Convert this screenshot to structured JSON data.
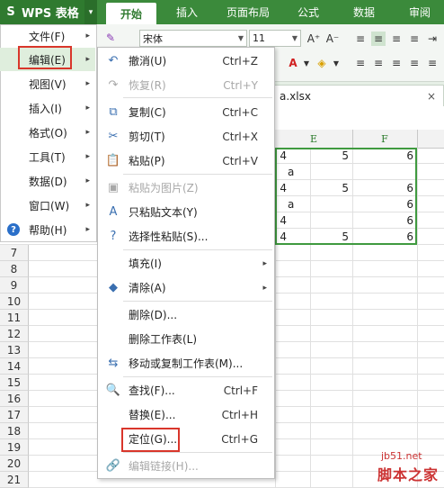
{
  "app": {
    "logo_glyph": "S",
    "title": "WPS 表格",
    "arrow": "▾"
  },
  "ribbon_tabs": [
    "开始",
    "插入",
    "页面布局",
    "公式",
    "数据",
    "审阅"
  ],
  "ribbon": {
    "font_name": "宋体",
    "font_size": "11",
    "grow": "A⁺",
    "shrink": "A⁻"
  },
  "doc_tab": {
    "name": "a.xlsx",
    "close": "×"
  },
  "columns": [
    "E",
    "F"
  ],
  "rows": [
    {
      "num": "",
      "c1": "4",
      "c2": "5",
      "c3": "6"
    },
    {
      "num": "",
      "c1": "",
      "c1t": "a",
      "c2": "",
      "c3": ""
    },
    {
      "num": "",
      "c1": "4",
      "c2": "5",
      "c3": "6"
    },
    {
      "num": "",
      "c1": "",
      "c1t": "a",
      "c2": "",
      "c3": "6"
    },
    {
      "num": "",
      "c1": "4",
      "c2": "",
      "c3": "6"
    },
    {
      "num": "",
      "c1": "4",
      "c2": "5",
      "c3": "6"
    }
  ],
  "row_numbers": [
    "7",
    "8",
    "9",
    "10",
    "11",
    "12",
    "13",
    "14",
    "15",
    "16",
    "17",
    "18",
    "19",
    "20",
    "21"
  ],
  "left_menu": [
    {
      "label": "文件(F)"
    },
    {
      "label": "编辑(E)"
    },
    {
      "label": "视图(V)"
    },
    {
      "label": "插入(I)"
    },
    {
      "label": "格式(O)"
    },
    {
      "label": "工具(T)"
    },
    {
      "label": "数据(D)"
    },
    {
      "label": "窗口(W)"
    },
    {
      "label": "帮助(H)"
    }
  ],
  "edit_menu": [
    {
      "label": "撤消(U)",
      "shortcut": "Ctrl+Z",
      "icon": "↶"
    },
    {
      "label": "恢复(R)",
      "shortcut": "Ctrl+Y",
      "icon": "↷"
    },
    {
      "label": "复制(C)",
      "shortcut": "Ctrl+C",
      "icon": "⧉"
    },
    {
      "label": "剪切(T)",
      "shortcut": "Ctrl+X",
      "icon": "✂"
    },
    {
      "label": "粘贴(P)",
      "shortcut": "Ctrl+V",
      "icon": "📋"
    },
    {
      "label": "粘贴为图片(Z)",
      "shortcut": "",
      "icon": "▣"
    },
    {
      "label": "只粘贴文本(Y)",
      "shortcut": "",
      "icon": "A"
    },
    {
      "label": "选择性粘贴(S)...",
      "shortcut": "",
      "icon": "?"
    },
    {
      "label": "填充(I)",
      "shortcut": "",
      "icon": ""
    },
    {
      "label": "清除(A)",
      "shortcut": "",
      "icon": "◆"
    },
    {
      "label": "删除(D)...",
      "shortcut": "",
      "icon": ""
    },
    {
      "label": "删除工作表(L)",
      "shortcut": "",
      "icon": ""
    },
    {
      "label": "移动或复制工作表(M)...",
      "shortcut": "",
      "icon": "⇆"
    },
    {
      "label": "查找(F)...",
      "shortcut": "Ctrl+F",
      "icon": "🔍"
    },
    {
      "label": "替换(E)...",
      "shortcut": "Ctrl+H",
      "icon": ""
    },
    {
      "label": "定位(G)...",
      "shortcut": "Ctrl+G",
      "icon": ""
    },
    {
      "label": "编辑链接(H)...",
      "shortcut": "",
      "icon": "🔗"
    }
  ],
  "submenu_arrow": "▸",
  "watermark": {
    "site": "jb51.net",
    "brand": "脚本之家"
  }
}
